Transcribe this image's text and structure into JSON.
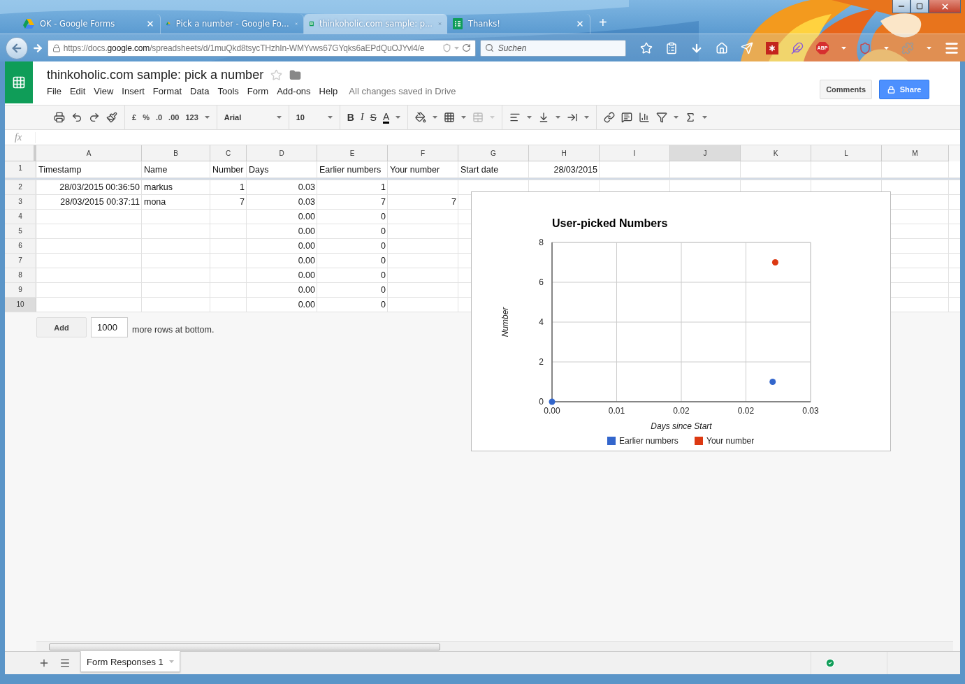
{
  "browser": {
    "tabs": [
      {
        "title": "OK - Google Forms",
        "kind": "drive",
        "selected": false
      },
      {
        "title": "Pick a number - Google Fo...",
        "kind": "drive",
        "selected": false
      },
      {
        "title": "thinkoholic.com sample: p...",
        "kind": "sheets",
        "selected": true
      },
      {
        "title": "Thanks!",
        "kind": "forms",
        "selected": false
      }
    ],
    "new_tab": "+",
    "url": {
      "prefix": "https://docs.",
      "domain": "google.com",
      "path": "/spreadsheets/d/1muQkd8tsycTHzhIn-WMYvws67GYqks6aEPdQuOJYvl4/e"
    },
    "search": {
      "placeholder": "Suchen"
    },
    "adblock_label": "ABP"
  },
  "app": {
    "title": "thinkoholic.com sample: pick a number",
    "menu": [
      "File",
      "Edit",
      "View",
      "Insert",
      "Format",
      "Data",
      "Tools",
      "Form",
      "Add-ons",
      "Help"
    ],
    "save_status": "All changes saved in Drive",
    "buttons": {
      "comments": "Comments",
      "share": "Share"
    }
  },
  "toolbar": {
    "number_formats": [
      "£",
      "%",
      ".0",
      ".00",
      "123"
    ],
    "font": "Arial",
    "font_size": "10",
    "text_styles": [
      {
        "kind": "bold",
        "label": "B"
      },
      {
        "kind": "italic",
        "label": "I"
      },
      {
        "kind": "strike",
        "label": "S"
      },
      {
        "kind": "color",
        "label": "A"
      }
    ]
  },
  "formula_bar": {
    "label": "fx"
  },
  "grid": {
    "columns": [
      {
        "label": "A",
        "selected": false
      },
      {
        "label": "B",
        "selected": false
      },
      {
        "label": "C",
        "selected": false
      },
      {
        "label": "D",
        "selected": false
      },
      {
        "label": "E",
        "selected": false
      },
      {
        "label": "F",
        "selected": false
      },
      {
        "label": "G",
        "selected": false
      },
      {
        "label": "H",
        "selected": false
      },
      {
        "label": "I",
        "selected": false
      },
      {
        "label": "J",
        "selected": true
      },
      {
        "label": "K",
        "selected": false
      },
      {
        "label": "L",
        "selected": false
      },
      {
        "label": "M",
        "selected": false
      }
    ],
    "rows": [
      {
        "label": "1",
        "selected": false,
        "cells": {
          "A": {
            "text": "Timestamp",
            "kind": "text"
          },
          "B": {
            "text": "Name",
            "kind": "text"
          },
          "C": {
            "text": "Number",
            "kind": "text"
          },
          "D": {
            "text": "Days",
            "kind": "text"
          },
          "E": {
            "text": "Earlier numbers",
            "kind": "text"
          },
          "F": {
            "text": "Your number",
            "kind": "text"
          },
          "G": {
            "text": "Start date",
            "kind": "text"
          },
          "H": {
            "text": "28/03/2015",
            "kind": "number"
          }
        }
      },
      {
        "label": "2",
        "selected": false,
        "cells": {
          "A": {
            "text": "28/03/2015 00:36:50",
            "kind": "number"
          },
          "B": {
            "text": "markus",
            "kind": "text"
          },
          "C": {
            "text": "1",
            "kind": "number"
          },
          "D": {
            "text": "0.03",
            "kind": "number"
          },
          "E": {
            "text": "1",
            "kind": "number"
          }
        }
      },
      {
        "label": "3",
        "selected": false,
        "cells": {
          "A": {
            "text": "28/03/2015 00:37:11",
            "kind": "number"
          },
          "B": {
            "text": "mona",
            "kind": "text"
          },
          "C": {
            "text": "7",
            "kind": "number"
          },
          "D": {
            "text": "0.03",
            "kind": "number"
          },
          "E": {
            "text": "7",
            "kind": "number"
          },
          "F": {
            "text": "7",
            "kind": "number"
          }
        }
      },
      {
        "label": "4",
        "selected": false,
        "cells": {
          "D": {
            "text": "0.00",
            "kind": "number"
          },
          "E": {
            "text": "0",
            "kind": "number"
          }
        }
      },
      {
        "label": "5",
        "selected": false,
        "cells": {
          "D": {
            "text": "0.00",
            "kind": "number"
          },
          "E": {
            "text": "0",
            "kind": "number"
          }
        }
      },
      {
        "label": "6",
        "selected": false,
        "cells": {
          "D": {
            "text": "0.00",
            "kind": "number"
          },
          "E": {
            "text": "0",
            "kind": "number"
          }
        }
      },
      {
        "label": "7",
        "selected": false,
        "cells": {
          "D": {
            "text": "0.00",
            "kind": "number"
          },
          "E": {
            "text": "0",
            "kind": "number"
          }
        }
      },
      {
        "label": "8",
        "selected": false,
        "cells": {
          "D": {
            "text": "0.00",
            "kind": "number"
          },
          "E": {
            "text": "0",
            "kind": "number"
          }
        }
      },
      {
        "label": "9",
        "selected": false,
        "cells": {
          "D": {
            "text": "0.00",
            "kind": "number"
          },
          "E": {
            "text": "0",
            "kind": "number"
          }
        }
      },
      {
        "label": "10",
        "selected": true,
        "cells": {
          "D": {
            "text": "0.00",
            "kind": "number"
          },
          "E": {
            "text": "0",
            "kind": "number"
          }
        }
      }
    ],
    "add_rows": {
      "button": "Add",
      "count": "1000",
      "suffix": "more rows at bottom."
    }
  },
  "chart": {
    "chart_data": {
      "type": "scatter",
      "title": "User-picked Numbers",
      "xlabel": "Days since Start",
      "ylabel": "Number",
      "x": [
        0.0256,
        0.0259,
        0
      ],
      "series": [
        {
          "name": "Earlier numbers",
          "color": "#3366cc",
          "values": [
            1,
            null,
            0
          ]
        },
        {
          "name": "Your number",
          "color": "#dc3912",
          "values": [
            null,
            7,
            null
          ]
        }
      ],
      "xlim": [
        0,
        0.03
      ],
      "ylim": [
        0,
        8
      ],
      "xticks": [
        {
          "value": 0,
          "label": "0.00"
        },
        {
          "value": 0.0075,
          "label": "0.01"
        },
        {
          "value": 0.015,
          "label": "0.02"
        },
        {
          "value": 0.0225,
          "label": "0.02"
        },
        {
          "value": 0.03,
          "label": "0.03"
        }
      ],
      "yticks": [
        {
          "value": 0,
          "label": "0"
        },
        {
          "value": 2,
          "label": "2"
        },
        {
          "value": 4,
          "label": "4"
        },
        {
          "value": 6,
          "label": "6"
        },
        {
          "value": 8,
          "label": "8"
        }
      ],
      "grid": true,
      "legend": true
    }
  },
  "sheets": {
    "tabs": [
      {
        "label": "Form Responses 1",
        "selected": true
      }
    ]
  }
}
